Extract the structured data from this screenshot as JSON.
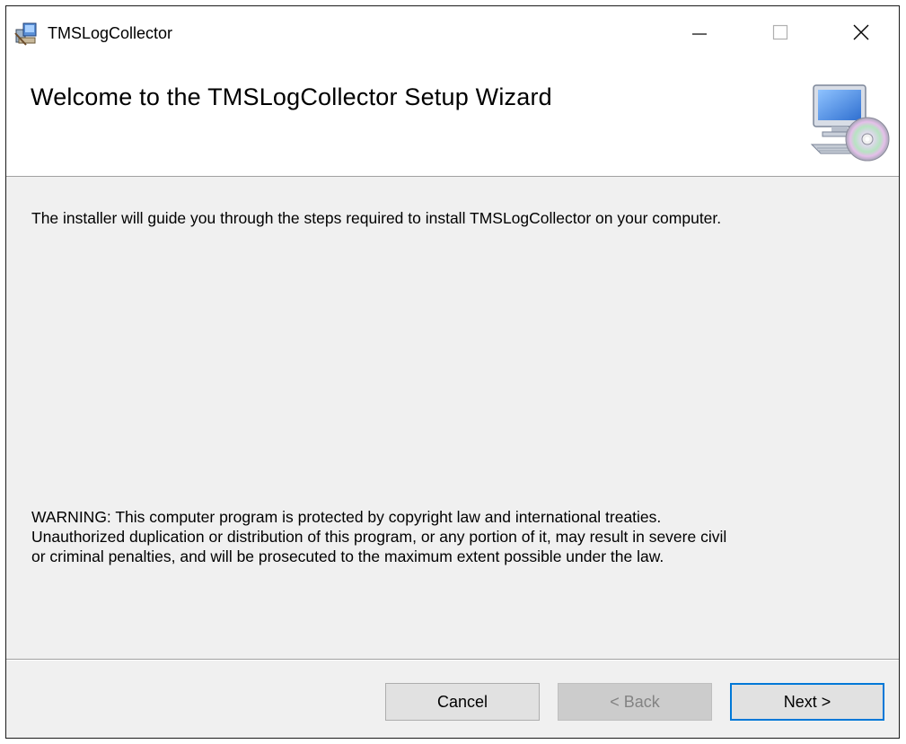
{
  "window": {
    "title": "TMSLogCollector",
    "controls": {
      "minimize_icon": "minimize-icon",
      "maximize_icon": "maximize-icon",
      "close_icon": "close-icon"
    }
  },
  "header": {
    "title": "Welcome to the TMSLogCollector Setup Wizard",
    "icon": "computer-cd-icon"
  },
  "body": {
    "intro": "The installer will guide you through the steps required to install TMSLogCollector on your computer.",
    "warning_lines": [
      "WARNING: This computer program is protected by copyright law and international treaties.",
      "Unauthorized duplication or distribution of this program, or any portion of it, may result in severe civil",
      "or criminal penalties, and will be prosecuted to the maximum extent possible under the law."
    ]
  },
  "buttons": {
    "cancel": "Cancel",
    "back": "< Back",
    "next": "Next >",
    "back_enabled": false,
    "default_button": "next"
  },
  "colors": {
    "focus_border": "#0078d7",
    "panel_bg": "#f0f0f0",
    "header_bg": "#ffffff",
    "disabled_text": "#838383"
  }
}
